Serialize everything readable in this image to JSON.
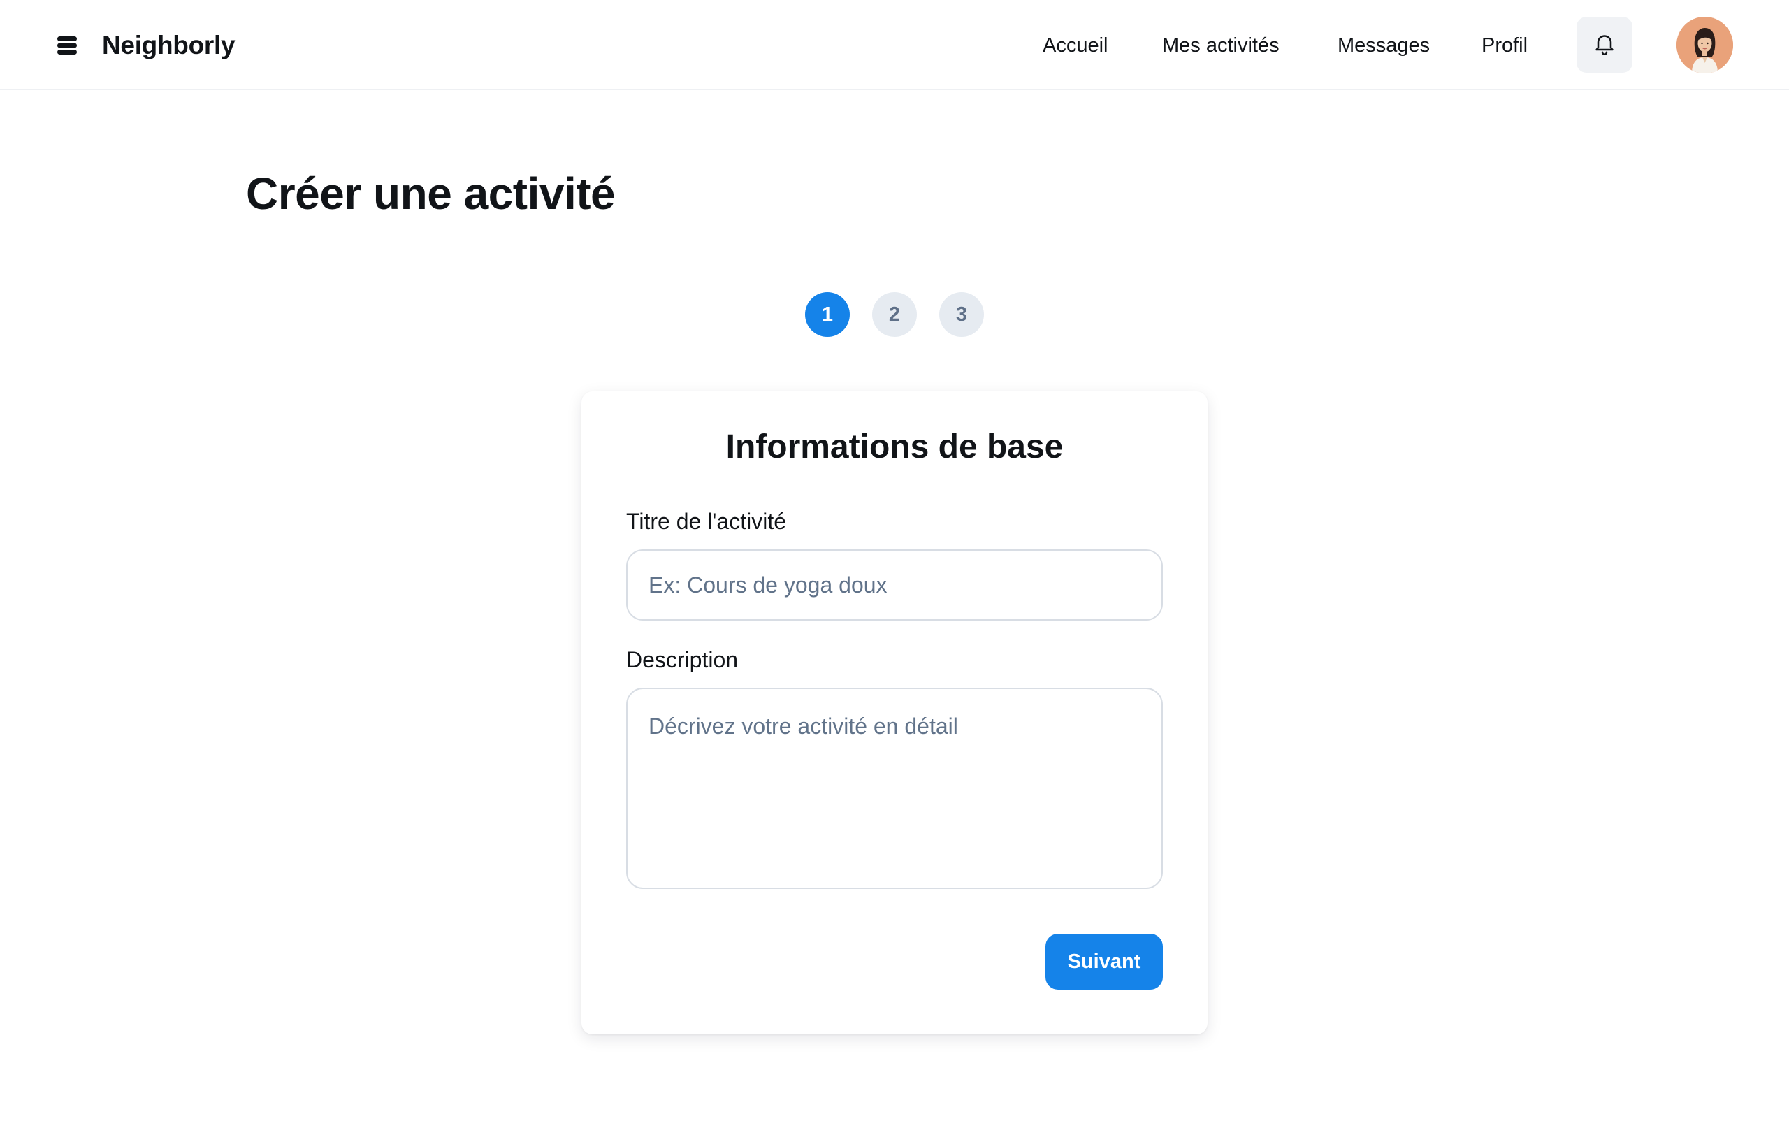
{
  "header": {
    "brand_name": "Neighborly",
    "brand_icon": "stacked-layers-icon",
    "nav": [
      {
        "label": "Accueil"
      },
      {
        "label": "Mes activités"
      },
      {
        "label": "Messages"
      },
      {
        "label": "Profil"
      }
    ],
    "notifications_icon": "bell-icon",
    "avatar_icon": "user-avatar"
  },
  "page": {
    "title": "Créer une activité"
  },
  "stepper": {
    "steps": [
      "1",
      "2",
      "3"
    ],
    "active_step": "1"
  },
  "form": {
    "title": "Informations de base",
    "title_field": {
      "label": "Titre de l'activité",
      "value": "",
      "placeholder": "Ex: Cours de yoga doux"
    },
    "description_field": {
      "label": "Description",
      "value": "",
      "placeholder": "Décrivez votre activité en détail"
    },
    "next_label": "Suivant"
  },
  "colors": {
    "accent": "#1583e9",
    "step_inactive_bg": "#e6ebf1",
    "step_inactive_text": "#5f7088",
    "text": "#111418",
    "placeholder": "#61738a",
    "border": "#d8dde4"
  }
}
